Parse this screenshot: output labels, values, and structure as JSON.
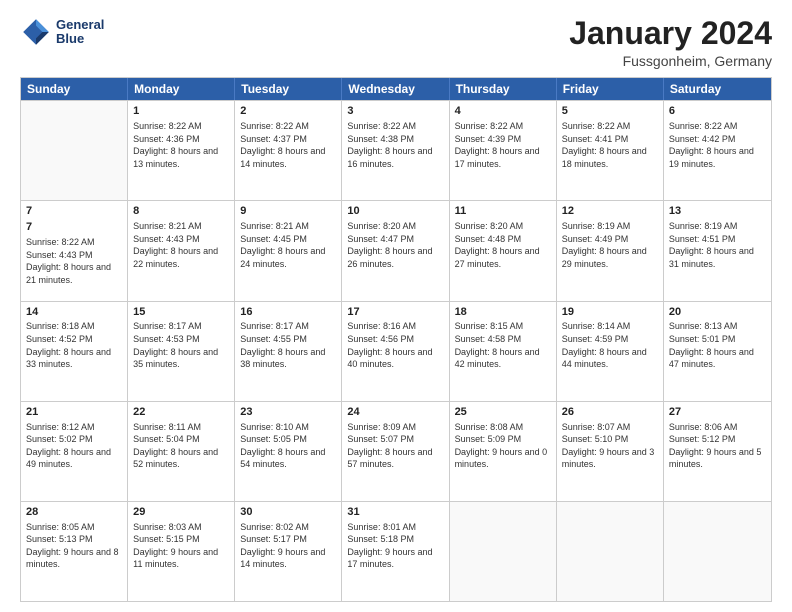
{
  "logo": {
    "line1": "General",
    "line2": "Blue"
  },
  "title": "January 2024",
  "subtitle": "Fussgonheim, Germany",
  "days": [
    "Sunday",
    "Monday",
    "Tuesday",
    "Wednesday",
    "Thursday",
    "Friday",
    "Saturday"
  ],
  "weeks": [
    [
      {
        "day": "",
        "info": ""
      },
      {
        "day": "1",
        "info": "Sunrise: 8:22 AM\nSunset: 4:36 PM\nDaylight: 8 hours\nand 13 minutes."
      },
      {
        "day": "2",
        "info": "Sunrise: 8:22 AM\nSunset: 4:37 PM\nDaylight: 8 hours\nand 14 minutes."
      },
      {
        "day": "3",
        "info": "Sunrise: 8:22 AM\nSunset: 4:38 PM\nDaylight: 8 hours\nand 16 minutes."
      },
      {
        "day": "4",
        "info": "Sunrise: 8:22 AM\nSunset: 4:39 PM\nDaylight: 8 hours\nand 17 minutes."
      },
      {
        "day": "5",
        "info": "Sunrise: 8:22 AM\nSunset: 4:41 PM\nDaylight: 8 hours\nand 18 minutes."
      },
      {
        "day": "6",
        "info": "Sunrise: 8:22 AM\nSunset: 4:42 PM\nDaylight: 8 hours\nand 19 minutes."
      }
    ],
    [
      {
        "day": "7",
        "info": ""
      },
      {
        "day": "8",
        "info": "Sunrise: 8:21 AM\nSunset: 4:43 PM\nDaylight: 8 hours\nand 22 minutes."
      },
      {
        "day": "9",
        "info": "Sunrise: 8:21 AM\nSunset: 4:45 PM\nDaylight: 8 hours\nand 24 minutes."
      },
      {
        "day": "10",
        "info": "Sunrise: 8:20 AM\nSunset: 4:47 PM\nDaylight: 8 hours\nand 26 minutes."
      },
      {
        "day": "11",
        "info": "Sunrise: 8:20 AM\nSunset: 4:48 PM\nDaylight: 8 hours\nand 27 minutes."
      },
      {
        "day": "12",
        "info": "Sunrise: 8:19 AM\nSunset: 4:49 PM\nDaylight: 8 hours\nand 29 minutes."
      },
      {
        "day": "13",
        "info": "Sunrise: 8:19 AM\nSunset: 4:51 PM\nDaylight: 8 hours\nand 31 minutes."
      }
    ],
    [
      {
        "day": "14",
        "info": "Sunrise: 8:18 AM\nSunset: 4:52 PM\nDaylight: 8 hours\nand 33 minutes."
      },
      {
        "day": "15",
        "info": "Sunrise: 8:17 AM\nSunset: 4:53 PM\nDaylight: 8 hours\nand 35 minutes."
      },
      {
        "day": "16",
        "info": "Sunrise: 8:17 AM\nSunset: 4:55 PM\nDaylight: 8 hours\nand 38 minutes."
      },
      {
        "day": "17",
        "info": "Sunrise: 8:16 AM\nSunset: 4:56 PM\nDaylight: 8 hours\nand 40 minutes."
      },
      {
        "day": "18",
        "info": "Sunrise: 8:15 AM\nSunset: 4:58 PM\nDaylight: 8 hours\nand 42 minutes."
      },
      {
        "day": "19",
        "info": "Sunrise: 8:14 AM\nSunset: 4:59 PM\nDaylight: 8 hours\nand 44 minutes."
      },
      {
        "day": "20",
        "info": "Sunrise: 8:13 AM\nSunset: 5:01 PM\nDaylight: 8 hours\nand 47 minutes."
      }
    ],
    [
      {
        "day": "21",
        "info": "Sunrise: 8:12 AM\nSunset: 5:02 PM\nDaylight: 8 hours\nand 49 minutes."
      },
      {
        "day": "22",
        "info": "Sunrise: 8:11 AM\nSunset: 5:04 PM\nDaylight: 8 hours\nand 52 minutes."
      },
      {
        "day": "23",
        "info": "Sunrise: 8:10 AM\nSunset: 5:05 PM\nDaylight: 8 hours\nand 54 minutes."
      },
      {
        "day": "24",
        "info": "Sunrise: 8:09 AM\nSunset: 5:07 PM\nDaylight: 8 hours\nand 57 minutes."
      },
      {
        "day": "25",
        "info": "Sunrise: 8:08 AM\nSunset: 5:09 PM\nDaylight: 9 hours\nand 0 minutes."
      },
      {
        "day": "26",
        "info": "Sunrise: 8:07 AM\nSunset: 5:10 PM\nDaylight: 9 hours\nand 3 minutes."
      },
      {
        "day": "27",
        "info": "Sunrise: 8:06 AM\nSunset: 5:12 PM\nDaylight: 9 hours\nand 5 minutes."
      }
    ],
    [
      {
        "day": "28",
        "info": "Sunrise: 8:05 AM\nSunset: 5:13 PM\nDaylight: 9 hours\nand 8 minutes."
      },
      {
        "day": "29",
        "info": "Sunrise: 8:03 AM\nSunset: 5:15 PM\nDaylight: 9 hours\nand 11 minutes."
      },
      {
        "day": "30",
        "info": "Sunrise: 8:02 AM\nSunset: 5:17 PM\nDaylight: 9 hours\nand 14 minutes."
      },
      {
        "day": "31",
        "info": "Sunrise: 8:01 AM\nSunset: 5:18 PM\nDaylight: 9 hours\nand 17 minutes."
      },
      {
        "day": "",
        "info": ""
      },
      {
        "day": "",
        "info": ""
      },
      {
        "day": "",
        "info": ""
      }
    ]
  ],
  "week7_sunday": {
    "info": "Sunrise: 8:22 AM\nSunset: 4:43 PM\nDaylight: 8 hours\nand 21 minutes."
  }
}
